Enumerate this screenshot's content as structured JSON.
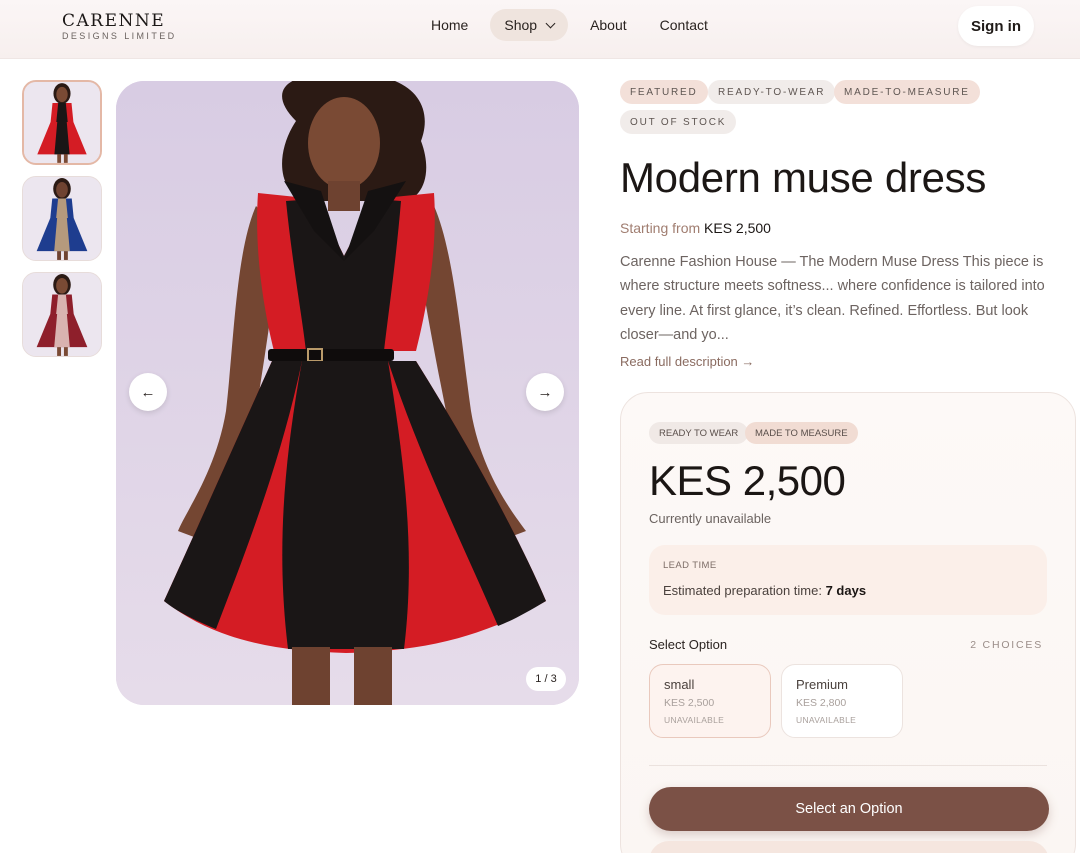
{
  "brand": {
    "name": "CARENNE",
    "subtitle": "DESIGNS LIMITED"
  },
  "nav": {
    "items": [
      "Home",
      "Shop",
      "About",
      "Contact"
    ],
    "active": "Shop",
    "signin": "Sign in"
  },
  "gallery": {
    "thumbnails": [
      {
        "dress_colors": [
          "#d41c24",
          "#1a1616"
        ],
        "skin": "#7a4a34",
        "selected": true
      },
      {
        "dress_colors": [
          "#1e3d8f",
          "#b59a7d"
        ],
        "skin": "#6f4331",
        "selected": false
      },
      {
        "dress_colors": [
          "#8e1f2b",
          "#d9b3b0"
        ],
        "skin": "#7a4a34",
        "selected": false
      }
    ],
    "prev_icon": "←",
    "next_icon": "→",
    "counter": "1 / 3"
  },
  "product": {
    "tags": [
      "FEATURED",
      "READY-TO-WEAR",
      "MADE-TO-MEASURE",
      "OUT OF STOCK"
    ],
    "title": "Modern muse dress",
    "starting_label": "Starting from",
    "starting_price": "KES 2,500",
    "description": "Carenne Fashion House — The Modern Muse Dress This piece is where structure meets softness... where confidence is tailored into every line. At first glance, it’s clean. Refined. Effortless. But look closer—and yo...",
    "read_more": "Read full description →"
  },
  "purchase": {
    "pills": [
      "READY TO WEAR",
      "MADE TO MEASURE"
    ],
    "price": "KES 2,500",
    "availability": "Currently unavailable",
    "lead_label": "LEAD TIME",
    "lead_text": "Estimated preparation time:",
    "lead_value": "7 days",
    "select_label": "Select Option",
    "choices_count": "2 CHOICES",
    "options": [
      {
        "name": "small",
        "price": "KES 2,500",
        "status": "UNAVAILABLE"
      },
      {
        "name": "Premium",
        "price": "KES 2,800",
        "status": "UNAVAILABLE"
      }
    ],
    "cta": "Select an Option"
  },
  "colors": {
    "accent_brown": "#7b5146",
    "tag_pink": "#f3e0d9",
    "dress_red": "#d41c24",
    "dress_black": "#1a1616"
  }
}
